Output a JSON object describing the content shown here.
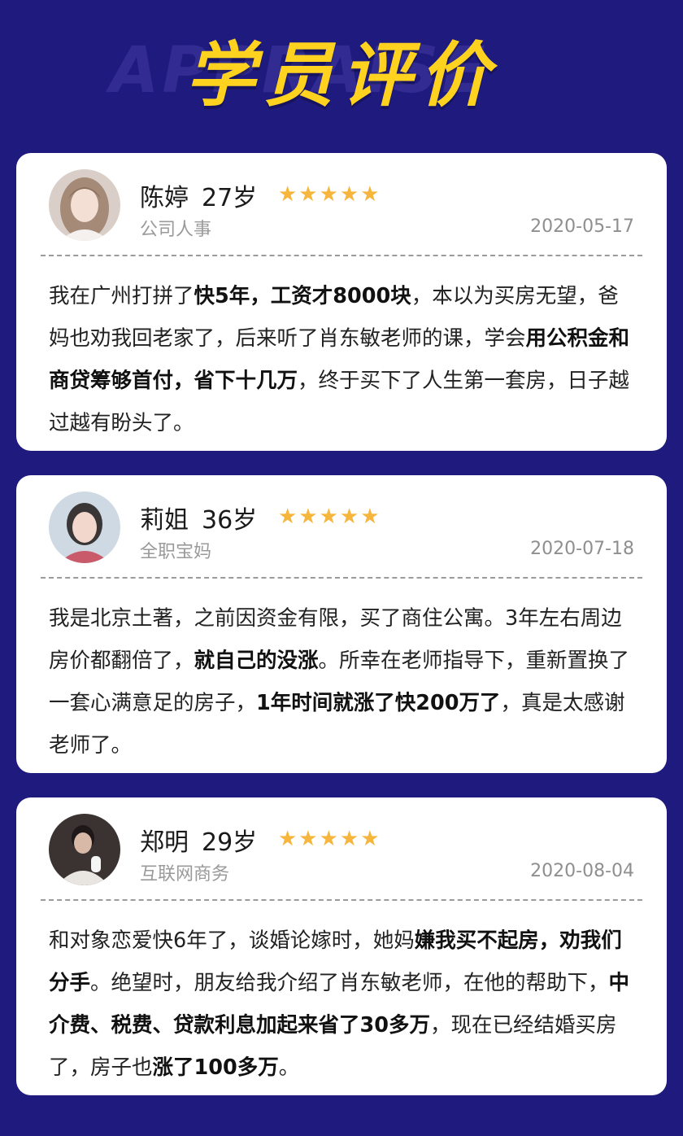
{
  "header": {
    "title": "学员评价",
    "background_word": "APPRAISE",
    "title_color": "#ffd21f",
    "background_color": "#1f1a7e"
  },
  "reviews": [
    {
      "name": "陈婷",
      "age": "27岁",
      "stars": "★★★★★",
      "rating": 5,
      "occupation": "公司人事",
      "date": "2020-05-17",
      "avatar_icon": "woman-portrait-avatar",
      "segments": [
        {
          "text": "我在广州打拼了",
          "bold": false
        },
        {
          "text": "快5年，工资才8000块",
          "bold": true
        },
        {
          "text": "，本以为买房无望，爸妈也劝我回老家了，后来听了肖东敏老师的课，学会",
          "bold": false
        },
        {
          "text": "用公积金和商贷筹够首付，省下十几万",
          "bold": true
        },
        {
          "text": "，终于买下了人生第一套房，日子越过越有盼头了。",
          "bold": false
        }
      ]
    },
    {
      "name": "莉姐",
      "age": "36岁",
      "stars": "★★★★★",
      "rating": 5,
      "occupation": "全职宝妈",
      "date": "2020-07-18",
      "avatar_icon": "woman-portrait-avatar",
      "segments": [
        {
          "text": "我是北京土著，之前因资金有限，买了商住公寓。3年左右周边房价都翻倍了，",
          "bold": false
        },
        {
          "text": "就自己的没涨",
          "bold": true
        },
        {
          "text": "。所幸在老师指导下，重新置换了一套心满意足的房子，",
          "bold": false
        },
        {
          "text": "1年时间就涨了快200万了",
          "bold": true
        },
        {
          "text": "，真是太感谢老师了。",
          "bold": false
        }
      ]
    },
    {
      "name": "郑明",
      "age": "29岁",
      "stars": "★★★★★",
      "rating": 5,
      "occupation": "互联网商务",
      "date": "2020-08-04",
      "avatar_icon": "man-portrait-avatar",
      "segments": [
        {
          "text": "和对象恋爱快6年了，谈婚论嫁时，她妈",
          "bold": false
        },
        {
          "text": "嫌我买不起房，劝我们分手",
          "bold": true
        },
        {
          "text": "。绝望时，朋友给我介绍了肖东敏老师，在他的帮助下，",
          "bold": false
        },
        {
          "text": "中介费、税费、贷款利息加起来省了30多万",
          "bold": true
        },
        {
          "text": "，现在已经结婚买房了，房子也",
          "bold": false
        },
        {
          "text": "涨了100多万",
          "bold": true
        },
        {
          "text": "。",
          "bold": false
        }
      ]
    }
  ]
}
